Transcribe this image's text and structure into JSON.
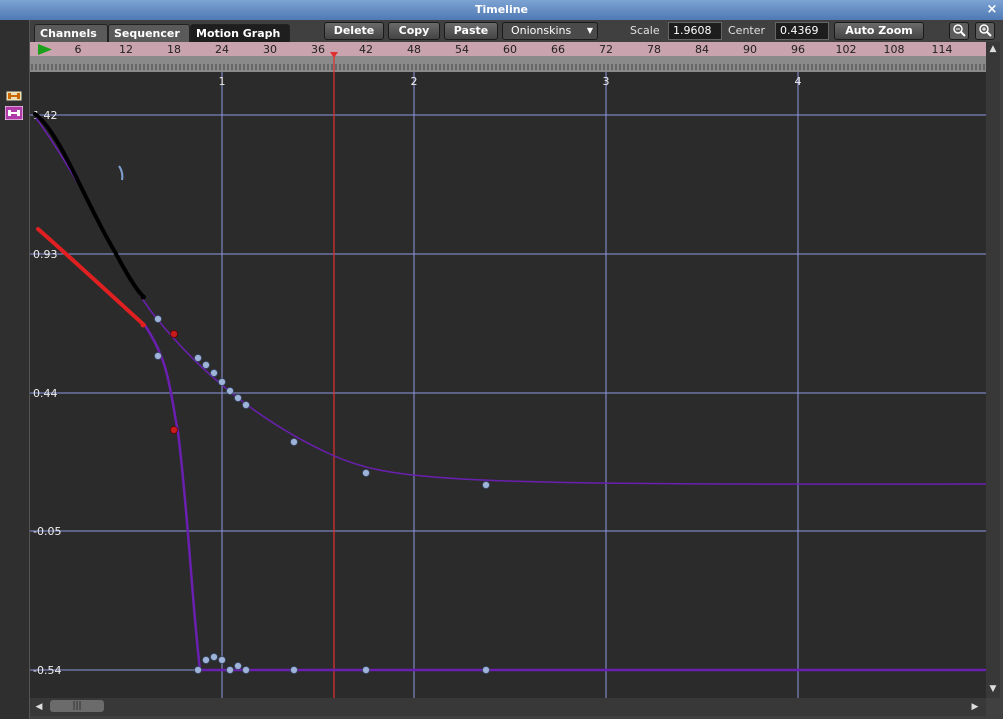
{
  "window": {
    "title": "Timeline",
    "close_glyph": "×"
  },
  "tabs": [
    {
      "label": "Channels",
      "active": false
    },
    {
      "label": "Sequencer",
      "active": false
    },
    {
      "label": "Motion Graph",
      "active": true
    }
  ],
  "toolbar": {
    "delete_label": "Delete",
    "copy_label": "Copy",
    "paste_label": "Paste",
    "onionskins_label": "Onionskins",
    "scale_label": "Scale",
    "scale_value": "1.9608",
    "center_label": "Center",
    "center_value": "0.4369",
    "autozoom_label": "Auto Zoom",
    "zoom_out_icon": "zoom-out-icon",
    "zoom_in_icon": "zoom-in-icon"
  },
  "ruler": {
    "frame_labels": [
      "6",
      "12",
      "18",
      "24",
      "30",
      "36",
      "42",
      "48",
      "54",
      "60",
      "66",
      "72",
      "78",
      "84",
      "90",
      "96",
      "102",
      "108",
      "114"
    ],
    "current_frame": 38,
    "play_icon": "play-icon"
  },
  "axis": {
    "time_labels": [
      "1",
      "2",
      "3",
      "4"
    ],
    "value_labels": [
      "1.42",
      "0.93",
      "0.44",
      "-0.05",
      "-0.54"
    ]
  },
  "colors": {
    "background": "#2b2b2b",
    "grid": "#8e98e0",
    "curve": "#6a1fb0",
    "playhead": "#e03030",
    "red_stroke": "#e02020",
    "black_stroke": "#000000",
    "ruler": "#c9a3ad",
    "key_point": "#9eb3d8"
  },
  "left_tools": [
    "bone-icon",
    "bone-selected-icon"
  ]
}
